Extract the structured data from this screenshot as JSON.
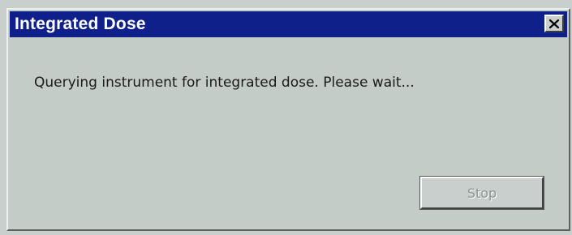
{
  "window": {
    "title": "Integrated Dose"
  },
  "dialog": {
    "message": "Querying instrument for integrated dose. Please wait...",
    "stop_label": "Stop",
    "stop_enabled": false
  },
  "icons": {
    "close": "close-icon"
  },
  "colors": {
    "titlebar": "#10208a",
    "dialog_background": "#c4ccc8",
    "disabled_text": "#8e9492"
  }
}
